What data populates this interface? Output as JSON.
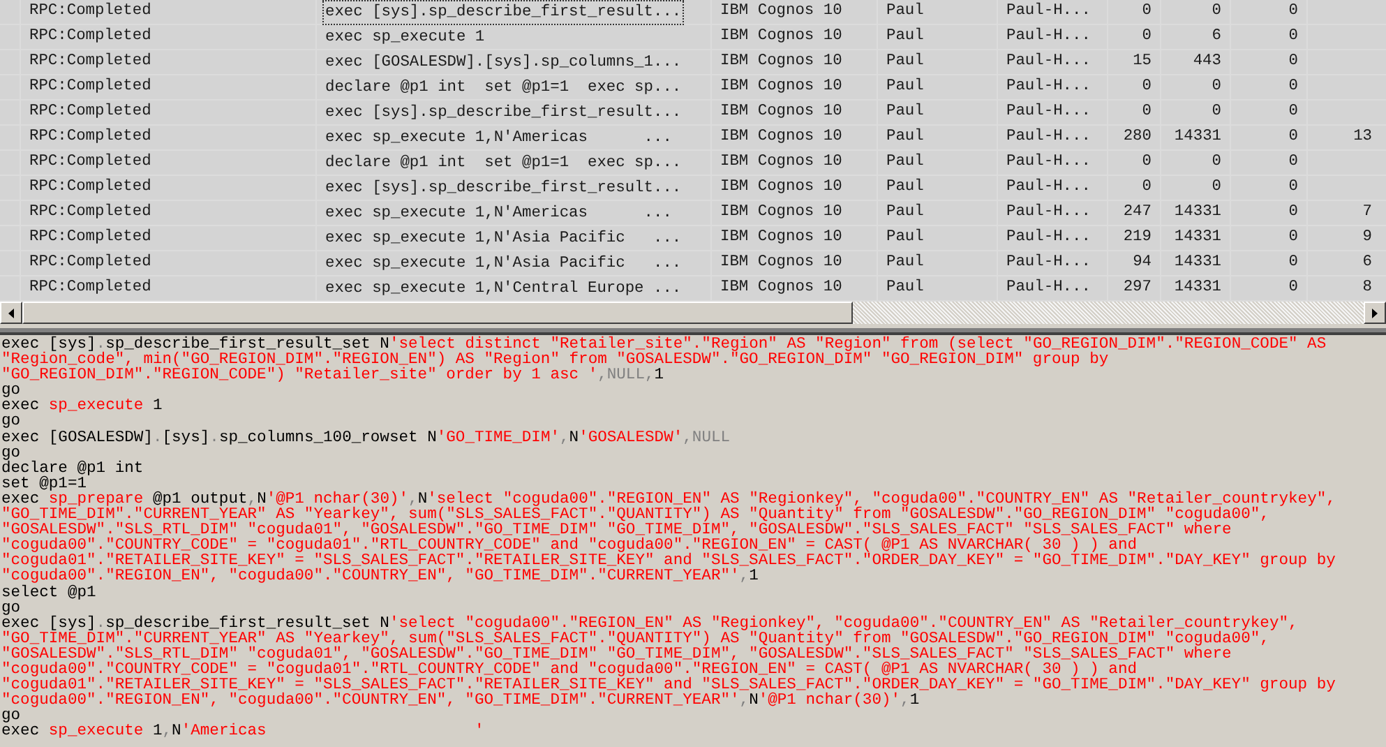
{
  "trace_grid": {
    "rows": [
      {
        "event": "RPC:Completed",
        "text": "exec [sys].sp_describe_first_result...",
        "application": "IBM Cognos 10",
        "user": "Paul",
        "host": "Paul-H...",
        "cpu": "0",
        "reads": "0",
        "writes": "0",
        "focused": true
      },
      {
        "event": "RPC:Completed",
        "text": "exec sp_execute 1",
        "application": "IBM Cognos 10",
        "user": "Paul",
        "host": "Paul-H...",
        "cpu": "0",
        "reads": "6",
        "writes": "0",
        "focused": false
      },
      {
        "event": "RPC:Completed",
        "text": "exec [GOSALESDW].[sys].sp_columns_1...",
        "application": "IBM Cognos 10",
        "user": "Paul",
        "host": "Paul-H...",
        "cpu": "15",
        "reads": "443",
        "writes": "0",
        "focused": false
      },
      {
        "event": "RPC:Completed",
        "text": "declare @p1 int  set @p1=1  exec sp...",
        "application": "IBM Cognos 10",
        "user": "Paul",
        "host": "Paul-H...",
        "cpu": "0",
        "reads": "0",
        "writes": "0",
        "focused": false
      },
      {
        "event": "RPC:Completed",
        "text": "exec [sys].sp_describe_first_result...",
        "application": "IBM Cognos 10",
        "user": "Paul",
        "host": "Paul-H...",
        "cpu": "0",
        "reads": "0",
        "writes": "0",
        "focused": false
      },
      {
        "event": "RPC:Completed",
        "text": "exec sp_execute 1,N'Americas      ...",
        "application": "IBM Cognos 10",
        "user": "Paul",
        "host": "Paul-H...",
        "cpu": "280",
        "reads": "14331",
        "writes": "0",
        "column_9": "13",
        "focused": false
      },
      {
        "event": "RPC:Completed",
        "text": "declare @p1 int  set @p1=1  exec sp...",
        "application": "IBM Cognos 10",
        "user": "Paul",
        "host": "Paul-H...",
        "cpu": "0",
        "reads": "0",
        "writes": "0",
        "focused": false
      },
      {
        "event": "RPC:Completed",
        "text": "exec [sys].sp_describe_first_result...",
        "application": "IBM Cognos 10",
        "user": "Paul",
        "host": "Paul-H...",
        "cpu": "0",
        "reads": "0",
        "writes": "0",
        "focused": false
      },
      {
        "event": "RPC:Completed",
        "text": "exec sp_execute 1,N'Americas      ...",
        "application": "IBM Cognos 10",
        "user": "Paul",
        "host": "Paul-H...",
        "cpu": "247",
        "reads": "14331",
        "writes": "0",
        "column_9": "7",
        "focused": false
      },
      {
        "event": "RPC:Completed",
        "text": "exec sp_execute 1,N'Asia Pacific   ...",
        "application": "IBM Cognos 10",
        "user": "Paul",
        "host": "Paul-H...",
        "cpu": "219",
        "reads": "14331",
        "writes": "0",
        "column_9": "9",
        "focused": false
      },
      {
        "event": "RPC:Completed",
        "text": "exec sp_execute 1,N'Asia Pacific   ...",
        "application": "IBM Cognos 10",
        "user": "Paul",
        "host": "Paul-H...",
        "cpu": "94",
        "reads": "14331",
        "writes": "0",
        "column_9": "6",
        "focused": false
      },
      {
        "event": "RPC:Completed",
        "text": "exec sp_execute 1,N'Central Europe ...",
        "application": "IBM Cognos 10",
        "user": "Paul",
        "host": "Paul-H...",
        "cpu": "297",
        "reads": "14331",
        "writes": "0",
        "column_9": "8",
        "focused": false
      }
    ]
  },
  "sql_text": {
    "lines": [
      [
        {
          "kind": "text",
          "text": "exec [sys]"
        },
        {
          "kind": "punct",
          "text": "."
        },
        {
          "kind": "text",
          "text": "sp_describe_first_result_set N"
        },
        {
          "kind": "string",
          "text": "'select distinct \"Retailer_site\".\"Region\" AS \"Region\" from (select \"GO_REGION_DIM\".\"REGION_CODE\" AS"
        }
      ],
      [
        {
          "kind": "string",
          "text": "\"Region_code\", min(\"GO_REGION_DIM\".\"REGION_EN\") AS \"Region\" from \"GOSALESDW\".\"GO_REGION_DIM\" \"GO_REGION_DIM\" group by"
        }
      ],
      [
        {
          "kind": "string",
          "text": "\"GO_REGION_DIM\".\"REGION_CODE\") \"Retailer_site\" order by 1 asc '"
        },
        {
          "kind": "punct",
          "text": ",NULL,"
        },
        {
          "kind": "text",
          "text": "1"
        }
      ],
      [
        {
          "kind": "text",
          "text": "go"
        }
      ],
      [
        {
          "kind": "text",
          "text": "exec "
        },
        {
          "kind": "string",
          "text": "sp_execute"
        },
        {
          "kind": "text",
          "text": " 1"
        }
      ],
      [
        {
          "kind": "text",
          "text": "go"
        }
      ],
      [
        {
          "kind": "text",
          "text": "exec [GOSALESDW]"
        },
        {
          "kind": "punct",
          "text": "."
        },
        {
          "kind": "text",
          "text": "[sys]"
        },
        {
          "kind": "punct",
          "text": "."
        },
        {
          "kind": "text",
          "text": "sp_columns_100_rowset N"
        },
        {
          "kind": "string",
          "text": "'GO_TIME_DIM'"
        },
        {
          "kind": "punct",
          "text": ","
        },
        {
          "kind": "text",
          "text": "N"
        },
        {
          "kind": "string",
          "text": "'GOSALESDW'"
        },
        {
          "kind": "punct",
          "text": ",NULL"
        }
      ],
      [
        {
          "kind": "text",
          "text": "go"
        }
      ],
      [
        {
          "kind": "text",
          "text": "declare @p1 int"
        }
      ],
      [
        {
          "kind": "text",
          "text": "set @p1=1"
        }
      ],
      [
        {
          "kind": "text",
          "text": "exec "
        },
        {
          "kind": "string",
          "text": "sp_prepare"
        },
        {
          "kind": "text",
          "text": " @p1 output"
        },
        {
          "kind": "punct",
          "text": ","
        },
        {
          "kind": "text",
          "text": "N"
        },
        {
          "kind": "string",
          "text": "'@P1 nchar(30)'"
        },
        {
          "kind": "punct",
          "text": ","
        },
        {
          "kind": "text",
          "text": "N"
        },
        {
          "kind": "string",
          "text": "'select \"coguda00\".\"REGION_EN\" AS \"Regionkey\", \"coguda00\".\"COUNTRY_EN\" AS \"Retailer_countrykey\","
        }
      ],
      [
        {
          "kind": "string",
          "text": "\"GO_TIME_DIM\".\"CURRENT_YEAR\" AS \"Yearkey\", sum(\"SLS_SALES_FACT\".\"QUANTITY\") AS \"Quantity\" from \"GOSALESDW\".\"GO_REGION_DIM\" \"coguda00\","
        }
      ],
      [
        {
          "kind": "string",
          "text": "\"GOSALESDW\".\"SLS_RTL_DIM\" \"coguda01\", \"GOSALESDW\".\"GO_TIME_DIM\" \"GO_TIME_DIM\", \"GOSALESDW\".\"SLS_SALES_FACT\" \"SLS_SALES_FACT\" where"
        }
      ],
      [
        {
          "kind": "string",
          "text": "\"coguda00\".\"COUNTRY_CODE\" = \"coguda01\".\"RTL_COUNTRY_CODE\" and \"coguda00\".\"REGION_EN\" = CAST( @P1 AS NVARCHAR( 30 ) ) and"
        }
      ],
      [
        {
          "kind": "string",
          "text": "\"coguda01\".\"RETAILER_SITE_KEY\" = \"SLS_SALES_FACT\".\"RETAILER_SITE_KEY\" and \"SLS_SALES_FACT\".\"ORDER_DAY_KEY\" = \"GO_TIME_DIM\".\"DAY_KEY\" group by"
        }
      ],
      [
        {
          "kind": "string",
          "text": "\"coguda00\".\"REGION_EN\", \"coguda00\".\"COUNTRY_EN\", \"GO_TIME_DIM\".\"CURRENT_YEAR\"'"
        },
        {
          "kind": "punct",
          "text": ","
        },
        {
          "kind": "text",
          "text": "1"
        }
      ],
      [
        {
          "kind": "text",
          "text": "select @p1"
        }
      ],
      [
        {
          "kind": "text",
          "text": "go"
        }
      ],
      [
        {
          "kind": "text",
          "text": "exec [sys]"
        },
        {
          "kind": "punct",
          "text": "."
        },
        {
          "kind": "text",
          "text": "sp_describe_first_result_set N"
        },
        {
          "kind": "string",
          "text": "'select \"coguda00\".\"REGION_EN\" AS \"Regionkey\", \"coguda00\".\"COUNTRY_EN\" AS \"Retailer_countrykey\","
        }
      ],
      [
        {
          "kind": "string",
          "text": "\"GO_TIME_DIM\".\"CURRENT_YEAR\" AS \"Yearkey\", sum(\"SLS_SALES_FACT\".\"QUANTITY\") AS \"Quantity\" from \"GOSALESDW\".\"GO_REGION_DIM\" \"coguda00\","
        }
      ],
      [
        {
          "kind": "string",
          "text": "\"GOSALESDW\".\"SLS_RTL_DIM\" \"coguda01\", \"GOSALESDW\".\"GO_TIME_DIM\" \"GO_TIME_DIM\", \"GOSALESDW\".\"SLS_SALES_FACT\" \"SLS_SALES_FACT\" where"
        }
      ],
      [
        {
          "kind": "string",
          "text": "\"coguda00\".\"COUNTRY_CODE\" = \"coguda01\".\"RTL_COUNTRY_CODE\" and \"coguda00\".\"REGION_EN\" = CAST( @P1 AS NVARCHAR( 30 ) ) and"
        }
      ],
      [
        {
          "kind": "string",
          "text": "\"coguda01\".\"RETAILER_SITE_KEY\" = \"SLS_SALES_FACT\".\"RETAILER_SITE_KEY\" and \"SLS_SALES_FACT\".\"ORDER_DAY_KEY\" = \"GO_TIME_DIM\".\"DAY_KEY\" group by"
        }
      ],
      [
        {
          "kind": "string",
          "text": "\"coguda00\".\"REGION_EN\", \"coguda00\".\"COUNTRY_EN\", \"GO_TIME_DIM\".\"CURRENT_YEAR\"'"
        },
        {
          "kind": "punct",
          "text": ","
        },
        {
          "kind": "text",
          "text": "N"
        },
        {
          "kind": "string",
          "text": "'@P1 nchar(30)'"
        },
        {
          "kind": "punct",
          "text": ","
        },
        {
          "kind": "text",
          "text": "1"
        }
      ],
      [
        {
          "kind": "text",
          "text": "go"
        }
      ],
      [
        {
          "kind": "text",
          "text": "exec "
        },
        {
          "kind": "string",
          "text": "sp_execute"
        },
        {
          "kind": "text",
          "text": " 1"
        },
        {
          "kind": "punct",
          "text": ","
        },
        {
          "kind": "text",
          "text": "N"
        },
        {
          "kind": "string",
          "text": "'Americas                      '"
        }
      ]
    ]
  }
}
